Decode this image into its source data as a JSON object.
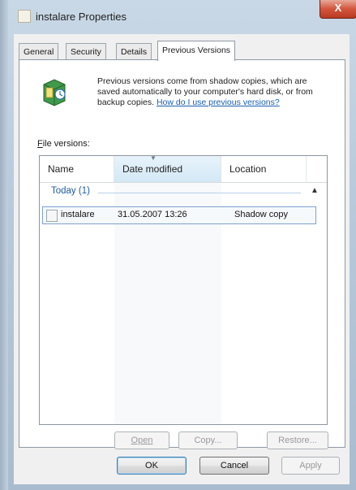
{
  "window": {
    "title": "instalare Properties",
    "close_label": "X"
  },
  "tabs": [
    {
      "label": "General"
    },
    {
      "label": "Security"
    },
    {
      "label": "Details"
    },
    {
      "label": "Previous Versions",
      "active": true
    }
  ],
  "info": {
    "text": "Previous versions come from shadow copies, which are saved automatically to your computer's hard disk, or from backup copies. ",
    "link": "How do I use previous versions?"
  },
  "file_versions": {
    "label_first": "F",
    "label_rest": "ile versions:",
    "columns": [
      "Name",
      "Date modified",
      "Location"
    ],
    "groups": [
      {
        "label": "Today (1)",
        "toggle": "▲",
        "rows": [
          {
            "name": "instalare",
            "date": "31.05.2007 13:26",
            "location": "Shadow copy"
          }
        ]
      }
    ]
  },
  "panel_buttons": {
    "open": "Open",
    "copy": "Copy...",
    "restore": "Restore..."
  },
  "dialog_buttons": {
    "ok": "OK",
    "cancel": "Cancel",
    "apply": "Apply"
  }
}
